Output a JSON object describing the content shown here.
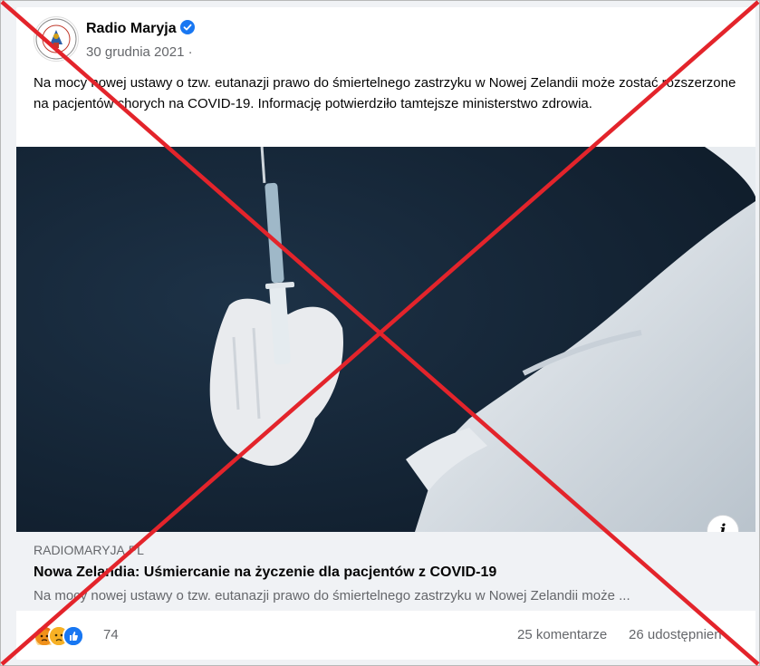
{
  "post": {
    "page_name": "Radio Maryja",
    "date": "30 grudnia 2021",
    "date_separator": "·",
    "text": "Na mocy nowej ustawy o tzw. eutanazji prawo do śmiertelnego zastrzyku w Nowej Zelandii może zostać rozszerzone na pacjentów chorych na COVID-19. Informację potwierdziło tamtejsze ministerstwo zdrowia."
  },
  "link": {
    "domain": "RADIOMARYJA.PL",
    "title": "Nowa Zelandia: Uśmiercanie na życzenie dla pacjentów z COVID-19",
    "description": "Na mocy nowej ustawy o tzw. eutanazji prawo do śmiertelnego zastrzyku w Nowej Zelandii może ..."
  },
  "info_icon": "i",
  "footer": {
    "reaction_count": "74",
    "comments": "25 komentarze",
    "shares": "26 udostępnień"
  },
  "colors": {
    "accent": "#1877f2",
    "cross": "#e3242b",
    "photo_bg": "#152536"
  },
  "icons": {
    "verified": "verified-badge-icon",
    "info": "info-icon",
    "reactions": [
      "angry-reaction-icon",
      "sad-reaction-icon",
      "like-reaction-icon"
    ]
  }
}
